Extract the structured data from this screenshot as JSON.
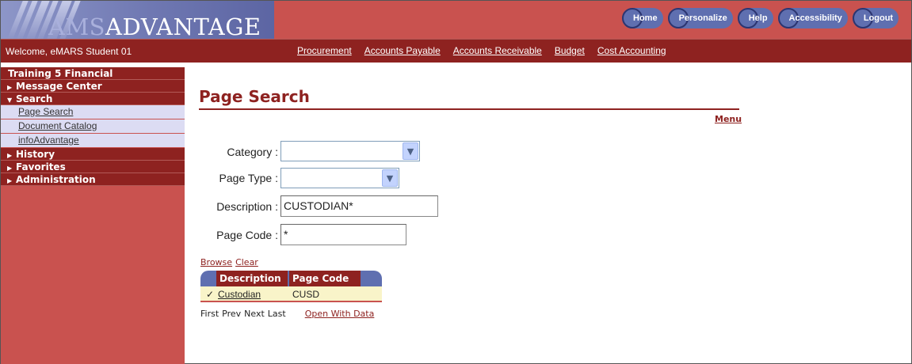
{
  "header": {
    "logo_prefix": "AMS",
    "logo_suffix": "ADVANTAGE",
    "nav": [
      "Home",
      "Personalize",
      "Help",
      "Accessibility",
      "Logout"
    ]
  },
  "subbar": {
    "welcome": "Welcome, eMARS Student 01",
    "modules": [
      "Procurement",
      "Accounts Payable",
      "Accounts Receivable",
      "Budget",
      "Cost Accounting"
    ]
  },
  "sidebar": {
    "title": "Training 5 Financial",
    "message_center": "Message Center",
    "search": "Search",
    "search_items": [
      "Page Search",
      "Document Catalog",
      "infoAdvantage"
    ],
    "history": "History",
    "favorites": "Favorites",
    "administration": "Administration"
  },
  "main": {
    "title": "Page Search",
    "menu_link": "Menu",
    "fields": {
      "category_label": "Category :",
      "category_value": "",
      "page_type_label": "Page Type :",
      "page_type_value": "",
      "description_label": "Description :",
      "description_value": "CUSTODIAN*",
      "page_code_label": "Page Code :",
      "page_code_value": "*"
    },
    "browse": "Browse",
    "clear": "Clear",
    "results": {
      "headers": [
        "Description",
        "Page Code"
      ],
      "rows": [
        {
          "check": "✓",
          "description": "Custodian",
          "page_code": "CUSD"
        }
      ]
    },
    "pager": {
      "first": "First",
      "prev": "Prev",
      "next": "Next",
      "last": "Last",
      "open_with_data": "Open With Data"
    }
  },
  "colors": {
    "brand_red": "#c9524f",
    "dark_red": "#8e2220",
    "nav_blue": "#5f6fb0",
    "link_bg": "#dcdcf3",
    "row_highlight": "#f9f4c9"
  }
}
